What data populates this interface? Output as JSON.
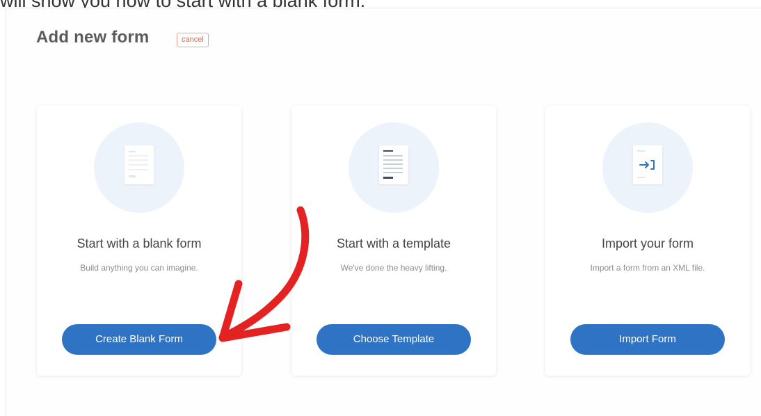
{
  "caption": "will show you how to start with a blank form.",
  "header": {
    "title": "Add new form",
    "cancel_label": "cancel"
  },
  "cards": [
    {
      "title": "Start with a blank form",
      "description": "Build anything you can imagine.",
      "button_label": "Create Blank Form",
      "icon": "blank-document-icon"
    },
    {
      "title": "Start with a template",
      "description": "We've done the heavy lifting.",
      "button_label": "Choose Template",
      "icon": "template-document-icon"
    },
    {
      "title": "Import your form",
      "description": "Import a form from an XML file.",
      "button_label": "Import Form",
      "icon": "import-document-icon"
    }
  ],
  "colors": {
    "button": "#2f73c4",
    "cancel": "#e2643f",
    "annotation_arrow": "#e52222",
    "icon_circle": "#edf3fb"
  }
}
